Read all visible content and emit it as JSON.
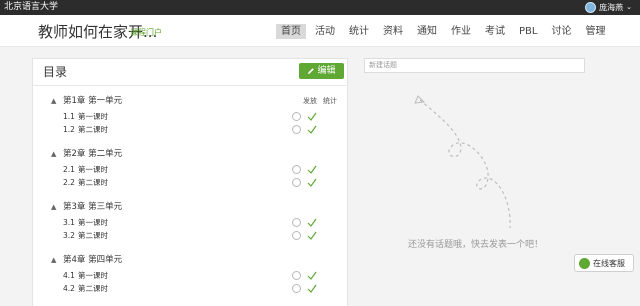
{
  "topbar": {
    "school_name": "北京语言大学",
    "user_name": "庞海燕",
    "caret": "⌄"
  },
  "header": {
    "course_title": "教师如何在家开...",
    "portal_link": "课程门户",
    "nav": [
      {
        "label": "首页",
        "active": true
      },
      {
        "label": "活动",
        "active": false
      },
      {
        "label": "统计",
        "active": false
      },
      {
        "label": "资料",
        "active": false
      },
      {
        "label": "通知",
        "active": false
      },
      {
        "label": "作业",
        "active": false
      },
      {
        "label": "考试",
        "active": false
      },
      {
        "label": "PBL",
        "active": false
      },
      {
        "label": "讨论",
        "active": false
      },
      {
        "label": "管理",
        "active": false
      }
    ]
  },
  "catalog": {
    "title": "目录",
    "edit_label": "编辑",
    "col_publish": "发放",
    "col_stats": "统计",
    "chapters": [
      {
        "title": "第1章 第一单元",
        "lessons": [
          {
            "num": "1.1",
            "title": "第一课时"
          },
          {
            "num": "1.2",
            "title": "第二课时"
          }
        ]
      },
      {
        "title": "第2章 第二单元",
        "lessons": [
          {
            "num": "2.1",
            "title": "第一课时"
          },
          {
            "num": "2.2",
            "title": "第二课时"
          }
        ]
      },
      {
        "title": "第3章 第三单元",
        "lessons": [
          {
            "num": "3.1",
            "title": "第一课时"
          },
          {
            "num": "3.2",
            "title": "第二课时"
          }
        ]
      },
      {
        "title": "第4章 第四单元",
        "lessons": [
          {
            "num": "4.1",
            "title": "第一课时"
          },
          {
            "num": "4.2",
            "title": "第二课时"
          }
        ]
      }
    ]
  },
  "discussion": {
    "new_topic_placeholder": "新建话题",
    "empty_message": "还没有话题哦，快去发表一个吧！"
  },
  "service": {
    "label": "在线客服"
  },
  "colors": {
    "accent_green": "#5fa833",
    "topbar_bg": "#2c2c2c"
  }
}
